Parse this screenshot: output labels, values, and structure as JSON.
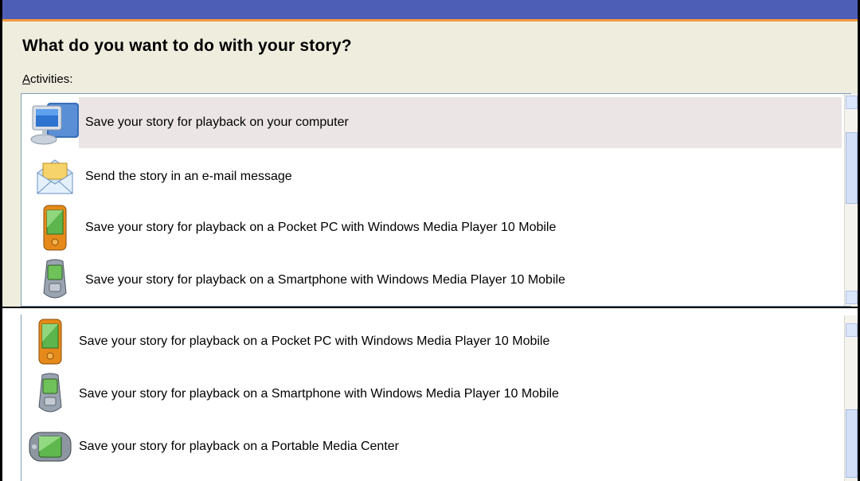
{
  "dialog": {
    "title": "What do you want to do with your story?",
    "activities_label_accel": "A",
    "activities_label_rest": "ctivities:"
  },
  "top_list": {
    "items": [
      {
        "label": "Save your story for playback on your computer",
        "icon": "computer-icon",
        "selected": true
      },
      {
        "label": "Send the story in an e-mail message",
        "icon": "email-envelope-icon",
        "selected": false
      },
      {
        "label": "Save your story for playback on a Pocket PC with Windows Media Player 10 Mobile",
        "icon": "pocket-pc-icon",
        "selected": false
      },
      {
        "label": "Save your story for playback on a Smartphone with Windows Media Player 10 Mobile",
        "icon": "smartphone-icon",
        "selected": false
      }
    ]
  },
  "bottom_list": {
    "items": [
      {
        "label": "Save your story for playback on a Pocket PC with Windows Media Player 10 Mobile",
        "icon": "pocket-pc-icon"
      },
      {
        "label": "Save your story for playback on a Smartphone with Windows Media Player 10 Mobile",
        "icon": "smartphone-icon"
      },
      {
        "label": "Save your story for playback on a Portable Media Center",
        "icon": "portable-media-center-icon"
      }
    ]
  },
  "colors": {
    "title_bar": "#4c5eb6",
    "title_bar_accent": "#f29a3f",
    "selection": "#ebe5e5"
  }
}
